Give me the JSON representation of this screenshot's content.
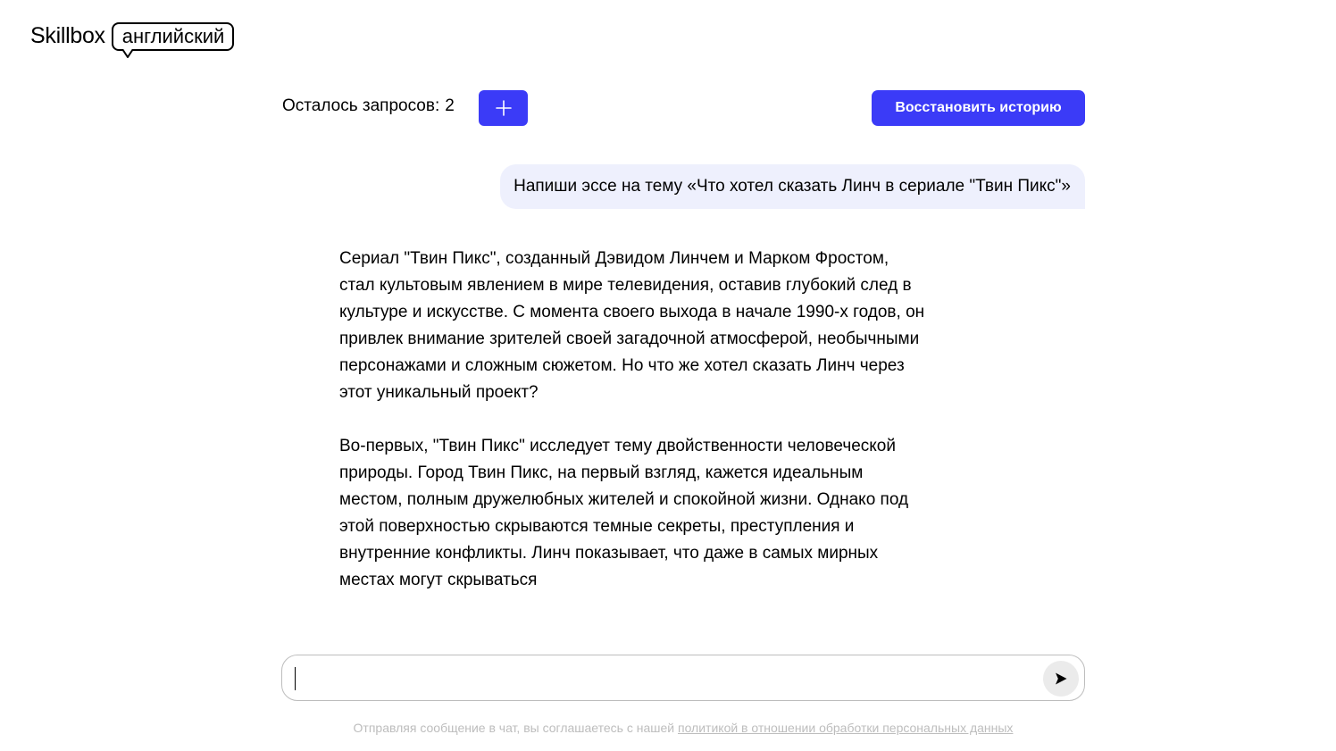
{
  "brand": {
    "name": "Skillbox",
    "tag": "английский"
  },
  "toolbar": {
    "requests_label": "Осталось запросов:",
    "requests_count": "2",
    "add_label": "+",
    "restore_label": "Восстановить историю"
  },
  "chat": {
    "user_message": "Напиши эссе на тему «Что хотел сказать Линч в сериале \"Твин Пикс\"»",
    "reply_paragraphs": [
      "Сериал \"Твин Пикс\", созданный Дэвидом Линчем и Марком Фростом, стал культовым явлением в мире телевидения, оставив глубокий след в культуре и искусстве. С момента своего выхода в начале 1990-х годов, он привлек внимание зрителей своей загадочной атмосферой, необычными персонажами и сложным сюжетом. Но что же хотел сказать Линч через этот уникальный проект?",
      "Во-первых, \"Твин Пикс\" исследует тему двойственности человеческой природы. Город Твин Пикс, на первый взгляд, кажется идеальным местом, полным дружелюбных жителей и спокойной жизни. Однако под этой поверхностью скрываются темные секреты, преступления и внутренние конфликты. Линч показывает, что даже в самых мирных местах могут скрываться"
    ]
  },
  "composer": {
    "value": "",
    "placeholder": ""
  },
  "footer": {
    "disclaimer_text": "Отправляя сообщение в чат, вы соглашаетесь с нашей",
    "policy_link": "политикой в отношении обработки персональных данных"
  },
  "colors": {
    "accent": "#3b3bf7",
    "user_bubble": "#eef0fd",
    "muted_text": "#bdbdbd"
  }
}
